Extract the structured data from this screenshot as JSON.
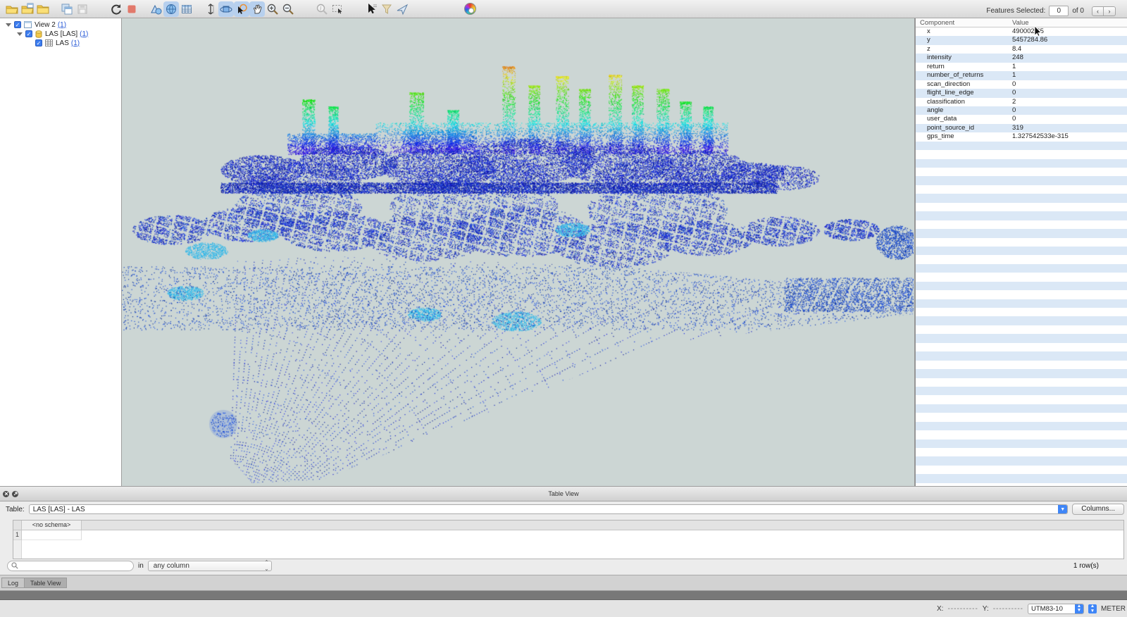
{
  "toolbar": {
    "icons": [
      "open-dataset",
      "add-dataset",
      "open-folder",
      "copy-view",
      "save-view",
      "refresh",
      "stop",
      "geometry-view",
      "view-3d",
      "table-view-tool",
      "measure",
      "orbit-3d",
      "select-tool",
      "pan-tool",
      "zoom-in",
      "zoom-out",
      "zoom-info",
      "zoom-extents",
      "query-tool",
      "filter",
      "locate",
      "color-wheel"
    ]
  },
  "features_panel": {
    "label": "Features Selected:",
    "selected_count": "0",
    "of_label": "of 0",
    "prev": "‹",
    "next": "›",
    "columns": {
      "component": "Component",
      "value": "Value"
    },
    "rows": [
      {
        "component": "x",
        "value": "490002.65"
      },
      {
        "component": "y",
        "value": "5457284.86"
      },
      {
        "component": "z",
        "value": "8.4"
      },
      {
        "component": "intensity",
        "value": "248"
      },
      {
        "component": "return",
        "value": "1"
      },
      {
        "component": "number_of_returns",
        "value": "1"
      },
      {
        "component": "scan_direction",
        "value": "0"
      },
      {
        "component": "flight_line_edge",
        "value": "0"
      },
      {
        "component": "classification",
        "value": "2"
      },
      {
        "component": "angle",
        "value": "0"
      },
      {
        "component": "user_data",
        "value": "0"
      },
      {
        "component": "point_source_id",
        "value": "319"
      },
      {
        "component": "gps_time",
        "value": "1.327542533e-315"
      }
    ]
  },
  "sidebar": {
    "items": [
      {
        "label": "View 2",
        "count": "(1)"
      },
      {
        "label": "LAS [LAS]",
        "count": "(1)"
      },
      {
        "label": "LAS",
        "count": "(1)"
      }
    ]
  },
  "table_view": {
    "title": "Table View",
    "table_label": "Table:",
    "table_value": "LAS [LAS] - LAS",
    "columns_button": "Columns...",
    "schema_header": "<no schema>",
    "first_row_number": "1",
    "search_value": "",
    "in_label": "in",
    "column_selector": "any column",
    "row_count": "1 row(s)"
  },
  "tabs": [
    {
      "label": "Log"
    },
    {
      "label": "Table View"
    }
  ],
  "status_bar": {
    "x_label": "X:",
    "x_value": "----------",
    "y_label": "Y:",
    "y_value": "----------",
    "coord_system": "UTM83-10",
    "units": "METER"
  }
}
